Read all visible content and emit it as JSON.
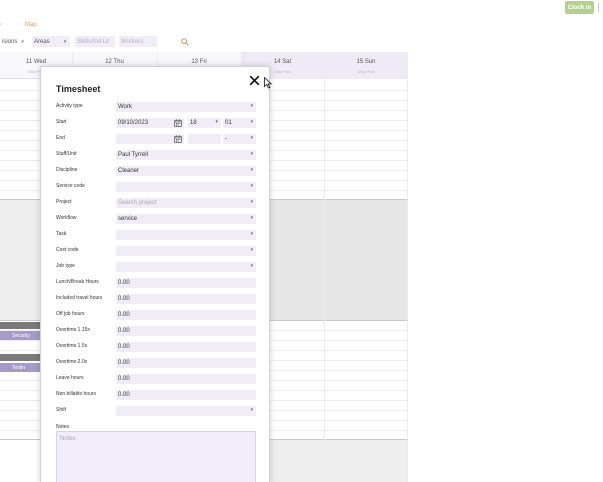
{
  "topbar": {
    "clock_in_label": "Clock in"
  },
  "nav": {
    "prev_label": "‹",
    "map_label": "Map"
  },
  "filters": {
    "divisions": "isions",
    "areas": "Areas",
    "skills_placeholder": "Skills/Ind.Lit",
    "workers_placeholder": "Workers"
  },
  "calendar": {
    "columns": [
      {
        "day": "11 Wed",
        "sub": "Map Pl..."
      },
      {
        "day": "12 Thu",
        "sub": ""
      },
      {
        "day": "13 Fri",
        "sub": ""
      },
      {
        "day": "14 Sat",
        "sub": "Map Port"
      },
      {
        "day": "15 Sun",
        "sub": "Map Port"
      }
    ],
    "events": [
      {
        "label": "Security"
      },
      {
        "label": "Testin"
      }
    ]
  },
  "modal": {
    "title": "Timesheet",
    "fields": {
      "activity_type": {
        "label": "Activity type",
        "value": "Work"
      },
      "start": {
        "label": "Start",
        "date": "09/10/2023",
        "hour": "18",
        "minute": "01"
      },
      "end": {
        "label": "End",
        "date": "",
        "hour": "",
        "minute": "-"
      },
      "staff_unit": {
        "label": "Staff/Unit",
        "value": "Paul Tyrrell"
      },
      "discipline": {
        "label": "Discipline",
        "value": "Cleaner"
      },
      "service_code": {
        "label": "Service code",
        "value": ""
      },
      "project": {
        "label": "Project",
        "placeholder": "Search project"
      },
      "workflow": {
        "label": "Workflow",
        "value": "service"
      },
      "task": {
        "label": "Task",
        "value": ""
      },
      "cost_code": {
        "label": "Cost code",
        "value": ""
      },
      "job_type": {
        "label": "Job type",
        "value": ""
      },
      "lunch_break": {
        "label": "Lunch/Break Hours",
        "value": "0.00"
      },
      "included_travel": {
        "label": "Included travel hours",
        "value": "0.00"
      },
      "off_job": {
        "label": "Off job hours",
        "value": "0.00"
      },
      "overtime_115": {
        "label": "Overtime 1.15x",
        "value": "0.00"
      },
      "overtime_15": {
        "label": "Overtime 1.5x",
        "value": "0.00"
      },
      "overtime_20": {
        "label": "Overtime 2.0x",
        "value": "0.00"
      },
      "leave": {
        "label": "Leave hours",
        "value": "0.00"
      },
      "non_billable": {
        "label": "Non billable hours",
        "value": "0.00"
      },
      "shift": {
        "label": "Shift",
        "value": ""
      },
      "notes": {
        "label": "Notes",
        "placeholder": "Notes"
      }
    }
  },
  "colors": {
    "accent_green": "#b6cf8f",
    "field_bg": "#f1edf8",
    "event_purple": "#a59bc9",
    "nav_orange": "#d89a6a"
  },
  "icons": {
    "close": "close-icon",
    "calendar": "calendar-icon",
    "search": "search-icon",
    "dropdown": "chevron-down-icon"
  }
}
